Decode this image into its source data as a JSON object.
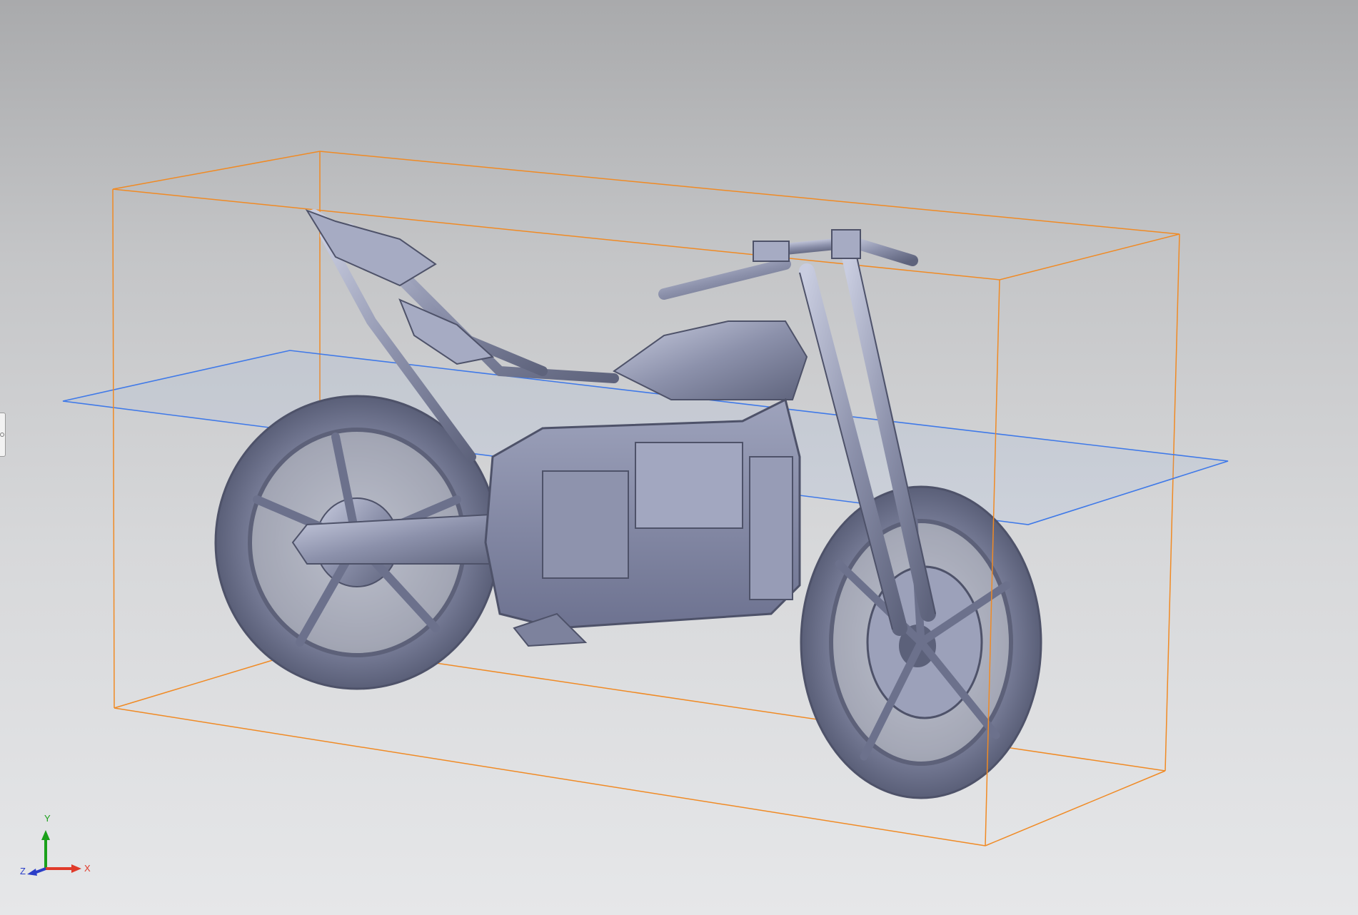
{
  "viewport": {
    "background_top": "#a9aaac",
    "background_bottom": "#e6e7e9",
    "bounding_box_color": "#f08a24",
    "section_plane_color": "#3f79e8",
    "mesh_color": "#8d93ad"
  },
  "triad": {
    "y_label": "Y",
    "x_label": "X",
    "z_label": "Z",
    "y_color": "#1aa01a",
    "x_color": "#e03a2a",
    "z_color": "#2b3ec8"
  },
  "model": {
    "icon": "motorcycle-scan-mesh"
  }
}
